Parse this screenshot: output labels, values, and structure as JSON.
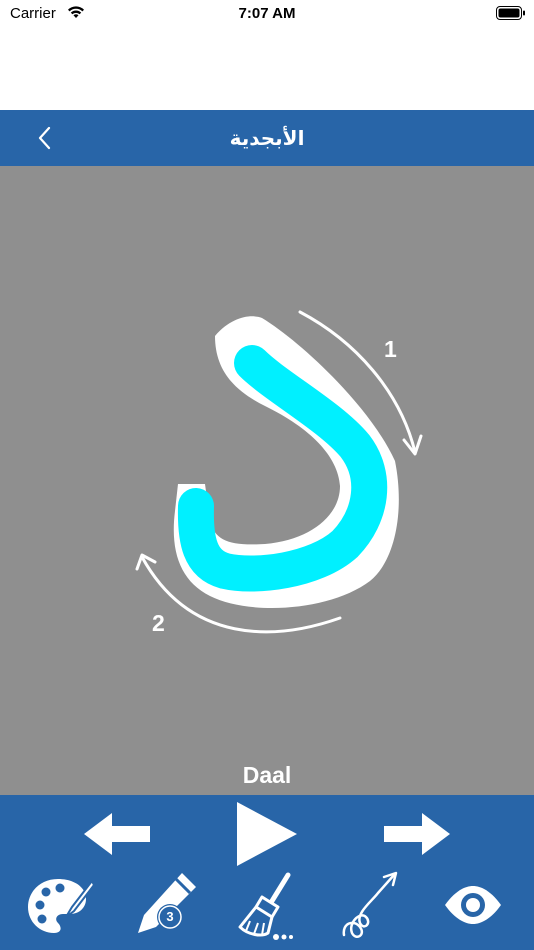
{
  "status": {
    "carrier": "Carrier",
    "time": "7:07 AM"
  },
  "nav": {
    "title": "الأبجدية"
  },
  "letter": {
    "name": "Daal",
    "stroke_numbers": [
      "1",
      "2"
    ],
    "trace_color": "#00f0ff"
  },
  "toolbar": {
    "pencil_size": "3",
    "icons": [
      "previous-arrow-icon",
      "play-icon",
      "next-arrow-icon",
      "palette-icon",
      "pencil-icon",
      "broom-icon",
      "trace-path-icon",
      "eye-icon"
    ]
  },
  "colors": {
    "nav_bg": "#2865a8",
    "canvas_bg": "#8f8f8f"
  }
}
